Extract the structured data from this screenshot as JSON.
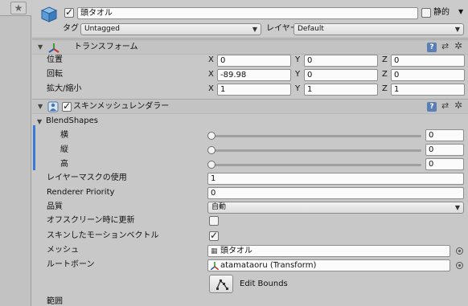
{
  "left_panel": {
    "star_icon": "star-icon"
  },
  "header": {
    "object_name": "頭タオル",
    "static_label": "静的",
    "tag_label": "タグ",
    "tag_value": "Untagged",
    "layer_label": "レイヤー",
    "layer_value": "Default"
  },
  "transform": {
    "title": "トランスフォーム",
    "rows": [
      {
        "label": "位置",
        "x": "0",
        "y": "0",
        "z": "0"
      },
      {
        "label": "回転",
        "x": "-89.98",
        "y": "0",
        "z": "0"
      },
      {
        "label": "拡大/縮小",
        "x": "1",
        "y": "1",
        "z": "1"
      }
    ],
    "axis_x": "X",
    "axis_y": "Y",
    "axis_z": "Z"
  },
  "skinned_mesh": {
    "title": "スキンメッシュレンダラー",
    "blendshapes_label": "BlendShapes",
    "blendshapes": [
      {
        "label": "横",
        "value": "0",
        "level": 0
      },
      {
        "label": "縦",
        "value": "0",
        "level": 0
      },
      {
        "label": "高",
        "value": "0",
        "level": 0
      }
    ],
    "layer_mask_label": "レイヤーマスクの使用",
    "layer_mask_value": "1",
    "renderer_priority_label": "Renderer Priority",
    "renderer_priority_value": "0",
    "quality_label": "品質",
    "quality_value": "自動",
    "offscreen_label": "オフスクリーン時に更新",
    "offscreen_checked": false,
    "skinned_motion_label": "スキンしたモーションベクトル",
    "skinned_motion_checked": true,
    "mesh_label": "メッシュ",
    "mesh_value": "頭タオル",
    "root_bone_label": "ルートボーン",
    "root_bone_value": "atamataoru (Transform)",
    "edit_bounds_label": "Edit Bounds",
    "bounds_label": "範囲"
  }
}
